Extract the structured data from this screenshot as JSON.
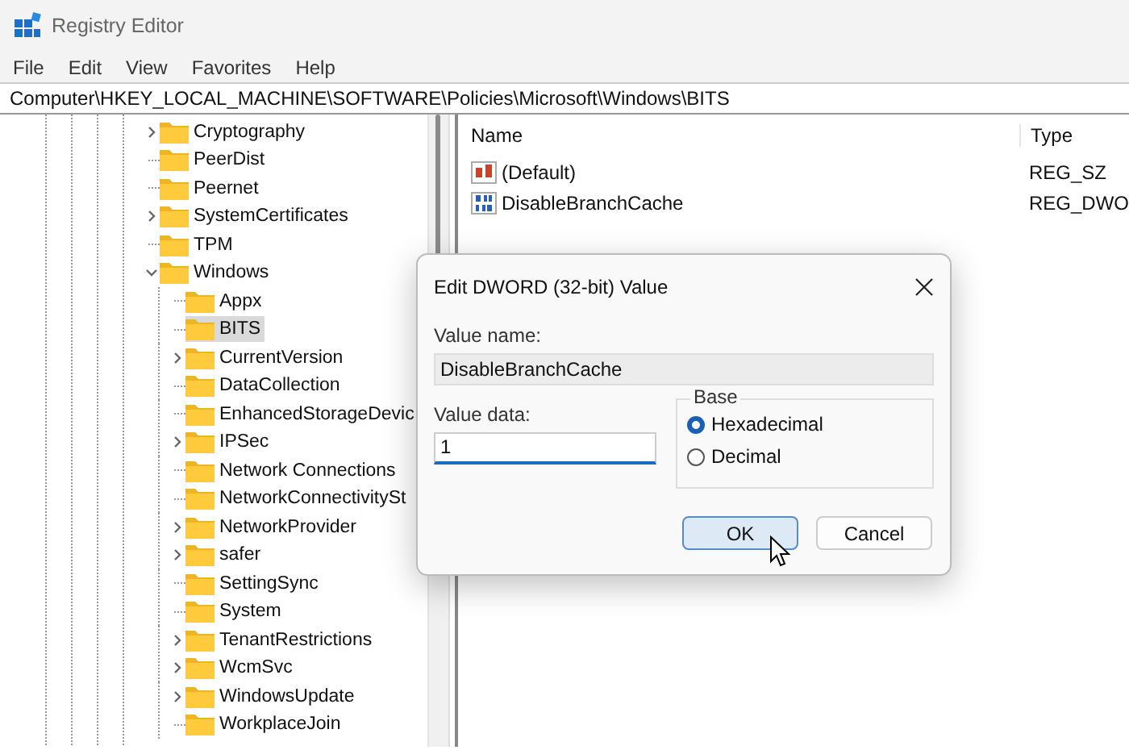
{
  "window": {
    "title": "Registry Editor"
  },
  "menu": [
    "File",
    "Edit",
    "View",
    "Favorites",
    "Help"
  ],
  "address_bar": {
    "value": "Computer\\HKEY_LOCAL_MACHINE\\SOFTWARE\\Policies\\Microsoft\\Windows\\BITS"
  },
  "tree": {
    "items": [
      {
        "label": "Cryptography",
        "kind": "branch",
        "expanded": false,
        "selected": false
      },
      {
        "label": "PeerDist",
        "kind": "leaf",
        "selected": false
      },
      {
        "label": "Peernet",
        "kind": "leaf",
        "selected": false
      },
      {
        "label": "SystemCertificates",
        "kind": "branch",
        "expanded": false,
        "selected": false
      },
      {
        "label": "TPM",
        "kind": "leaf",
        "selected": false
      },
      {
        "label": "Windows",
        "kind": "branch",
        "expanded": true,
        "selected": false,
        "children": [
          {
            "label": "Appx",
            "kind": "leaf",
            "selected": false
          },
          {
            "label": "BITS",
            "kind": "leaf",
            "selected": true
          },
          {
            "label": "CurrentVersion",
            "kind": "branch",
            "expanded": false,
            "selected": false
          },
          {
            "label": "DataCollection",
            "kind": "leaf",
            "selected": false
          },
          {
            "label": "EnhancedStorageDevic",
            "kind": "leaf",
            "selected": false
          },
          {
            "label": "IPSec",
            "kind": "branch",
            "expanded": false,
            "selected": false
          },
          {
            "label": "Network Connections",
            "kind": "leaf",
            "selected": false
          },
          {
            "label": "NetworkConnectivitySt",
            "kind": "leaf",
            "selected": false
          },
          {
            "label": "NetworkProvider",
            "kind": "branch",
            "expanded": false,
            "selected": false
          },
          {
            "label": "safer",
            "kind": "branch",
            "expanded": false,
            "selected": false
          },
          {
            "label": "SettingSync",
            "kind": "leaf",
            "selected": false
          },
          {
            "label": "System",
            "kind": "leaf",
            "selected": false
          },
          {
            "label": "TenantRestrictions",
            "kind": "branch",
            "expanded": false,
            "selected": false
          },
          {
            "label": "WcmSvc",
            "kind": "branch",
            "expanded": false,
            "selected": false
          },
          {
            "label": "WindowsUpdate",
            "kind": "branch",
            "expanded": false,
            "selected": false
          },
          {
            "label": "WorkplaceJoin",
            "kind": "leaf",
            "selected": false
          }
        ]
      }
    ]
  },
  "values_list": {
    "columns": [
      "Name",
      "Type"
    ],
    "rows": [
      {
        "kind": "string",
        "name": "(Default)",
        "type": "REG_SZ"
      },
      {
        "kind": "number",
        "name": "DisableBranchCache",
        "type": "REG_DWO"
      }
    ]
  },
  "dialog": {
    "title": "Edit DWORD (32-bit) Value",
    "value_name_label": "Value name:",
    "value_name": "DisableBranchCache",
    "value_data_label": "Value data:",
    "value_data": "1",
    "base": {
      "title": "Base",
      "options": [
        {
          "label": "Hexadecimal",
          "selected": true
        },
        {
          "label": "Decimal",
          "selected": false
        }
      ]
    },
    "buttons": [
      {
        "label": "OK",
        "kind": "default"
      },
      {
        "label": "Cancel",
        "kind": "normal"
      }
    ]
  }
}
